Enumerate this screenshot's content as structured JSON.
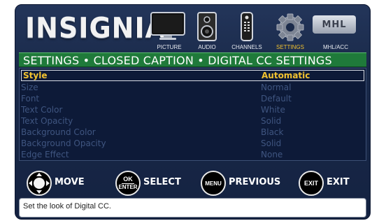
{
  "header": {
    "logo": "INSIGNIA",
    "menu": [
      {
        "label": "PICTURE",
        "icon": "tv-icon"
      },
      {
        "label": "AUDIO",
        "icon": "speaker-icon"
      },
      {
        "label": "CHANNELS",
        "icon": "remote-icon"
      },
      {
        "label": "SETTINGS",
        "icon": "gear-icon",
        "active": true
      },
      {
        "label": "MHL/ACC",
        "icon": "mhl-logo-icon",
        "logo_text": "MHL"
      }
    ]
  },
  "title": "SETTINGS • CLOSED CAPTION • DIGITAL CC SETTINGS",
  "settings": [
    {
      "label": "Style",
      "value": "Automatic",
      "selected": true
    },
    {
      "label": "Size",
      "value": "Normal"
    },
    {
      "label": "Font",
      "value": "Default"
    },
    {
      "label": "Text Color",
      "value": "White"
    },
    {
      "label": "Text Opacity",
      "value": "Solid"
    },
    {
      "label": "Background Color",
      "value": "Black"
    },
    {
      "label": "Background Opacity",
      "value": "Solid"
    },
    {
      "label": "Edge Effect",
      "value": "None"
    }
  ],
  "hints": [
    {
      "button": "",
      "label": "MOVE",
      "icon": "dpad-icon"
    },
    {
      "button_top": "OK",
      "button_bottom": "ENTER",
      "label": "SELECT"
    },
    {
      "button": "MENU",
      "label": "PREVIOUS"
    },
    {
      "button": "EXIT",
      "label": "EXIT"
    }
  ],
  "status": "Set the look of Digital CC.",
  "colors": {
    "highlight": "#f2c230",
    "title_bar": "#1f7a3a",
    "dimmed_text": "#3f5580",
    "background": "#142241"
  }
}
